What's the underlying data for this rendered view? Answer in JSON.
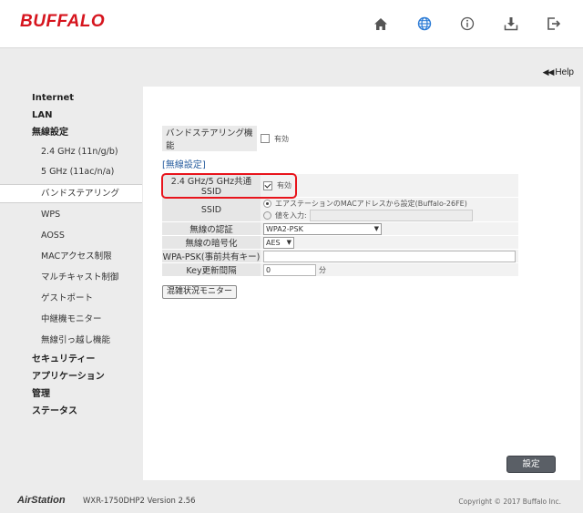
{
  "header": {
    "logo": "BUFFALO",
    "icons": [
      "home-icon",
      "globe-icon",
      "info-icon",
      "download-icon",
      "logout-icon"
    ]
  },
  "help": {
    "arrows": "◀◀",
    "label": "Help"
  },
  "sidebar": {
    "items": [
      {
        "label": "Internet",
        "level": "top"
      },
      {
        "label": "LAN",
        "level": "top"
      },
      {
        "label": "無線設定",
        "level": "top"
      },
      {
        "label": "2.4 GHz (11n/g/b)",
        "level": "sub"
      },
      {
        "label": "5 GHz (11ac/n/a)",
        "level": "sub"
      },
      {
        "label": "バンドステアリング",
        "level": "sub",
        "active": true
      },
      {
        "label": "WPS",
        "level": "sub"
      },
      {
        "label": "AOSS",
        "level": "sub"
      },
      {
        "label": "MACアクセス制限",
        "level": "sub"
      },
      {
        "label": "マルチキャスト制御",
        "level": "sub"
      },
      {
        "label": "ゲストポート",
        "level": "sub"
      },
      {
        "label": "中継機モニター",
        "level": "sub"
      },
      {
        "label": "無線引っ越し機能",
        "level": "sub"
      },
      {
        "label": "セキュリティー",
        "level": "top"
      },
      {
        "label": "アプリケーション",
        "level": "top"
      },
      {
        "label": "管理",
        "level": "top"
      },
      {
        "label": "ステータス",
        "level": "top"
      }
    ]
  },
  "band_steering": {
    "label": "バンドステアリング機能",
    "enable_label": "有効",
    "enabled": false
  },
  "section_title": "[無線設定]",
  "config": {
    "shared_ssid": {
      "label": "2.4 GHz/5 GHz共通SSID",
      "enable_label": "有効",
      "enabled": true
    },
    "ssid": {
      "label": "SSID",
      "option_mac": "エアステーションのMACアドレスから設定(Buffalo-26FE)",
      "option_manual": "値を入力:",
      "manual_value": ""
    },
    "auth": {
      "label": "無線の認証",
      "value": "WPA2-PSK"
    },
    "encryption": {
      "label": "無線の暗号化",
      "value": "AES"
    },
    "psk": {
      "label": "WPA-PSK(事前共有キー)",
      "value": ""
    },
    "key_interval": {
      "label": "Key更新間隔",
      "value": "0",
      "unit": "分"
    }
  },
  "buttons": {
    "monitor": "混雑状況モニター",
    "apply": "設定"
  },
  "footer": {
    "brand": "AirStation",
    "model": "WXR-1750DHP2   Version 2.56",
    "copyright": "Copyright © 2017 Buffalo Inc."
  }
}
